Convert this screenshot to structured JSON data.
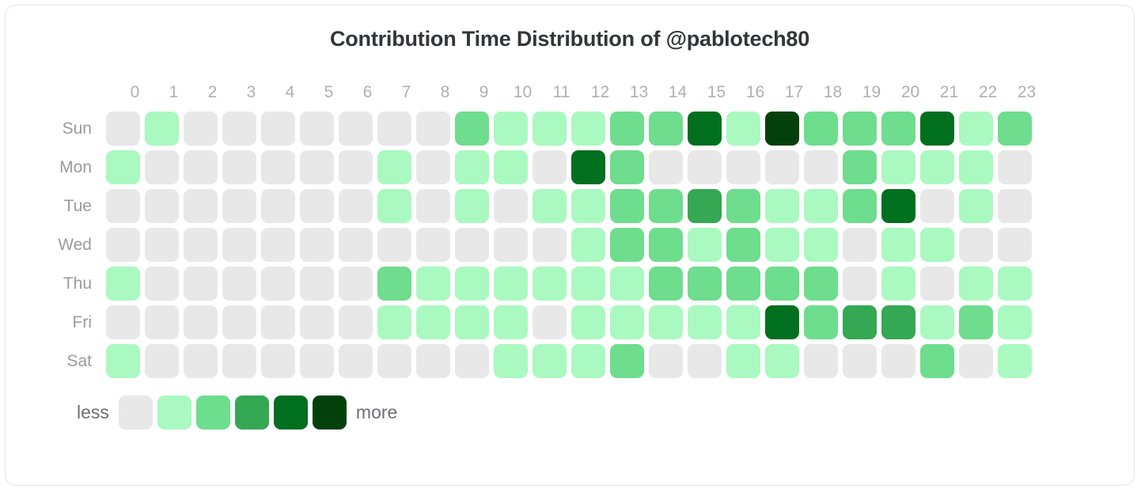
{
  "card": {
    "title": "Contribution Time Distribution of @pablotech80"
  },
  "legend": {
    "less_label": "less",
    "more_label": "more",
    "colors": [
      "#e8e8e8",
      "#aaf9c0",
      "#6edd8d",
      "#34a853",
      "#00701f",
      "#04400c"
    ]
  },
  "chart_data": {
    "type": "heatmap",
    "title": "Contribution Time Distribution of @pablotech80",
    "xlabel": "",
    "ylabel": "",
    "x_categories": [
      "0",
      "1",
      "2",
      "3",
      "4",
      "5",
      "6",
      "7",
      "8",
      "9",
      "10",
      "11",
      "12",
      "13",
      "14",
      "15",
      "16",
      "17",
      "18",
      "19",
      "20",
      "21",
      "22",
      "23"
    ],
    "y_categories": [
      "Sun",
      "Mon",
      "Tue",
      "Wed",
      "Thu",
      "Fri",
      "Sat"
    ],
    "level_scale": [
      0,
      1,
      2,
      3,
      4,
      5
    ],
    "level_colors": [
      "#e8e8e8",
      "#aaf9c0",
      "#6edd8d",
      "#34a853",
      "#00701f",
      "#04400c"
    ],
    "legend": {
      "low": "less",
      "high": "more",
      "position": "bottom-left"
    },
    "grid": false,
    "rows": [
      {
        "day": "Sun",
        "values": [
          0,
          1,
          0,
          0,
          0,
          0,
          0,
          0,
          0,
          2,
          1,
          1,
          1,
          2,
          2,
          4,
          1,
          5,
          2,
          2,
          2,
          4,
          1,
          2
        ]
      },
      {
        "day": "Mon",
        "values": [
          1,
          0,
          0,
          0,
          0,
          0,
          0,
          1,
          0,
          1,
          1,
          0,
          4,
          2,
          0,
          0,
          0,
          0,
          0,
          2,
          1,
          1,
          1,
          0
        ]
      },
      {
        "day": "Tue",
        "values": [
          0,
          0,
          0,
          0,
          0,
          0,
          0,
          1,
          0,
          1,
          0,
          1,
          1,
          2,
          2,
          3,
          2,
          1,
          1,
          2,
          4,
          0,
          1,
          0
        ]
      },
      {
        "day": "Wed",
        "values": [
          0,
          0,
          0,
          0,
          0,
          0,
          0,
          0,
          0,
          0,
          0,
          0,
          1,
          2,
          2,
          1,
          2,
          1,
          1,
          0,
          1,
          1,
          0,
          0
        ]
      },
      {
        "day": "Thu",
        "values": [
          1,
          0,
          0,
          0,
          0,
          0,
          0,
          2,
          1,
          1,
          1,
          1,
          1,
          1,
          2,
          2,
          2,
          2,
          2,
          0,
          1,
          0,
          1,
          1
        ]
      },
      {
        "day": "Fri",
        "values": [
          0,
          0,
          0,
          0,
          0,
          0,
          0,
          1,
          1,
          1,
          1,
          0,
          1,
          1,
          1,
          1,
          1,
          4,
          2,
          3,
          3,
          1,
          2,
          1
        ]
      },
      {
        "day": "Sat",
        "values": [
          1,
          0,
          0,
          0,
          0,
          0,
          0,
          0,
          0,
          0,
          1,
          1,
          1,
          2,
          0,
          0,
          1,
          1,
          0,
          0,
          0,
          2,
          0,
          1
        ]
      }
    ]
  }
}
